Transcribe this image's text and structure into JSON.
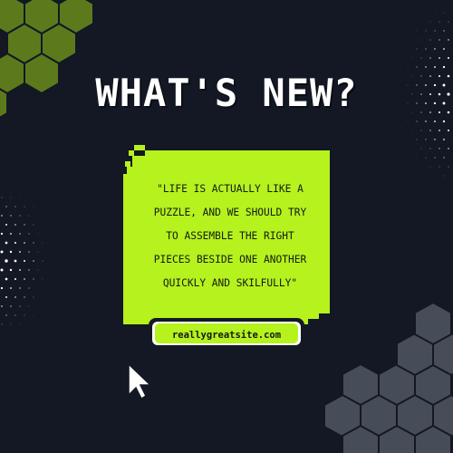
{
  "title": "WHAT'S NEW?",
  "quote": {
    "lines": [
      "\"LIFE IS ACTUALLY LIKE A",
      "PUZZLE, AND WE SHOULD TRY",
      "TO ASSEMBLE THE RIGHT",
      "PIECES BESIDE ONE ANOTHER",
      "QUICKLY AND SKILFULLY\""
    ]
  },
  "link": {
    "label": "reallygreatsite.com"
  },
  "icons": {
    "cursor": "pointer-cursor-icon"
  },
  "colors": {
    "background": "#131824",
    "accent": "#b5f21e",
    "hex_green": "#5c7a1c",
    "hex_gray": "#474c59",
    "text_light": "#ffffff"
  }
}
